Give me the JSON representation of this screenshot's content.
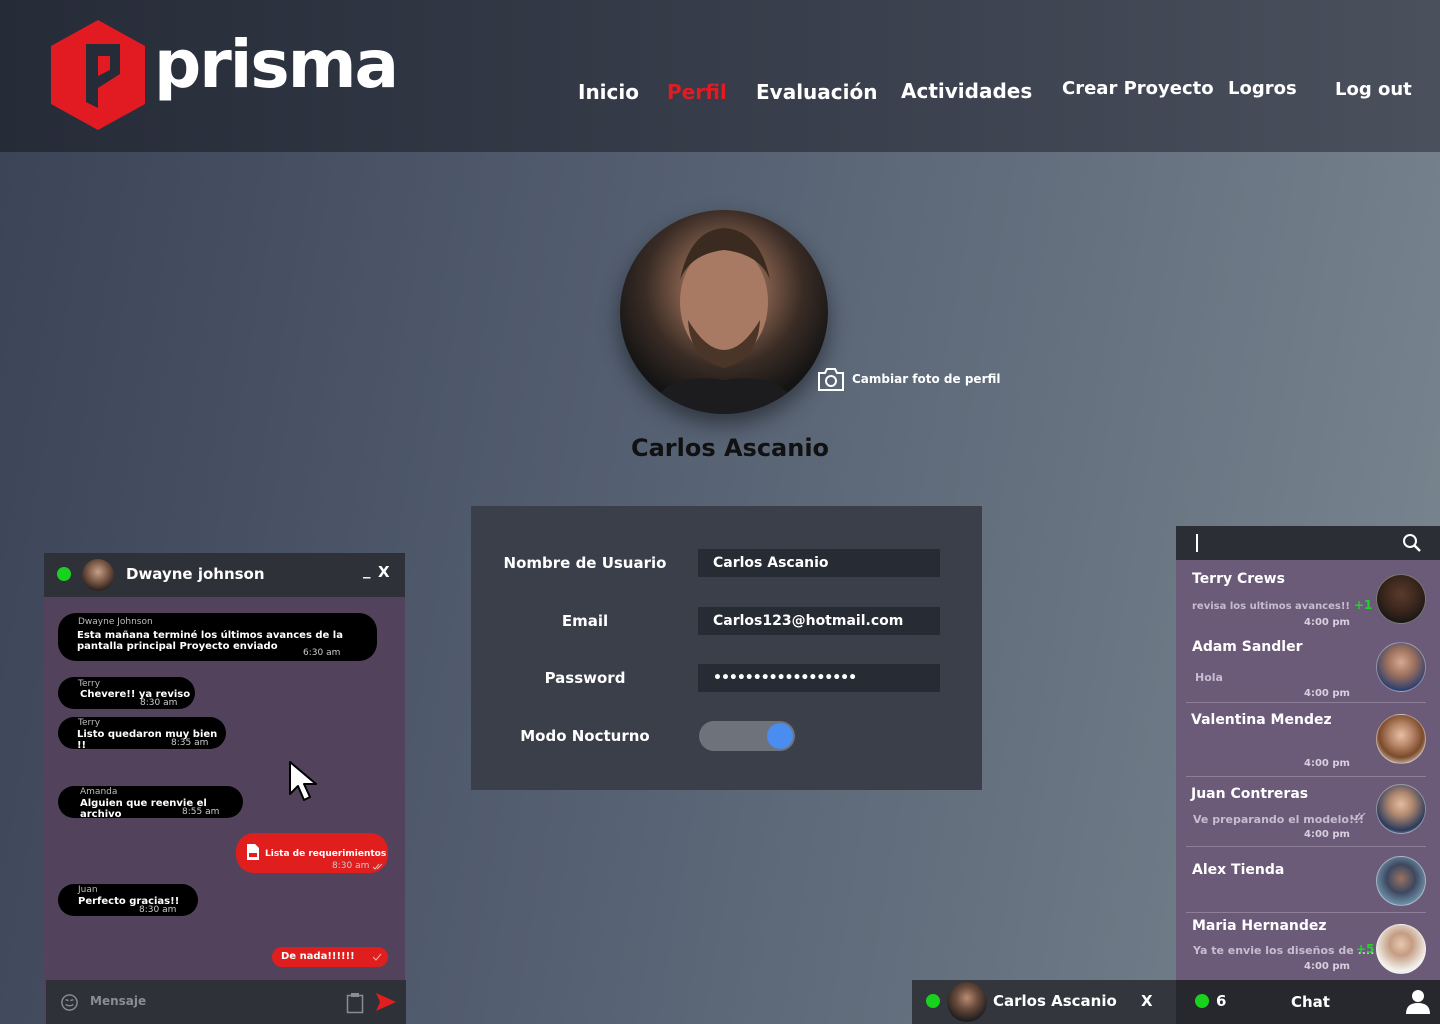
{
  "brand": {
    "name": "prisma",
    "accent": "#e21b23"
  },
  "nav": [
    {
      "label": "Inicio",
      "active": false
    },
    {
      "label": "Perfil",
      "active": true
    },
    {
      "label": "Evaluación",
      "active": false
    },
    {
      "label": "Actividades",
      "active": false
    },
    {
      "label": "Crear Proyecto",
      "active": false
    },
    {
      "label": "Logros",
      "active": false
    },
    {
      "label": "Log out",
      "active": false
    }
  ],
  "profile": {
    "name": "Carlos Ascanio",
    "change_photo_label": "Cambiar foto de perfil"
  },
  "form": {
    "username_label": "Nombre de Usuario",
    "username_value": "Carlos Ascanio",
    "email_label": "Email",
    "email_value": "Carlos123@hotmail.com",
    "password_label": "Password",
    "password_value": "••••••••••••••••••",
    "night_mode_label": "Modo Nocturno",
    "night_mode_on": true
  },
  "chat_window": {
    "title": "Dwayne johnson",
    "minimize_label": "_",
    "close_label": "X",
    "messages": [
      {
        "from": "Dwayne Johnson",
        "line1": "Esta mañana terminé los últimos avances de la",
        "line2": "pantalla principal Proyecto enviado",
        "time": "6:30 am"
      },
      {
        "from": "Terry",
        "line1": "Chevere!! ya reviso",
        "time": "8:30 am"
      },
      {
        "from": "Terry",
        "line1": "Listo quedaron muy bien !!",
        "time": "8:35 am"
      },
      {
        "from": "Amanda",
        "line1": "Alguien que reenvie el archivo",
        "time": "8:55 am"
      },
      {
        "file": "Lista de requerimientos",
        "time": "8:30 am"
      },
      {
        "from": "Juan",
        "line1": "Perfecto gracias!!",
        "time": "8:30 am"
      },
      {
        "line1": "De nada!!!!!!"
      }
    ],
    "input_placeholder": "Mensaje"
  },
  "chat_list": {
    "contacts": [
      {
        "name": "Terry Crews",
        "message": "revisa los ultimos avances!!",
        "badge": "+1",
        "time": "4:00 pm"
      },
      {
        "name": "Adam Sandler",
        "message": "Hola",
        "time": "4:00 pm"
      },
      {
        "name": "Valentina Mendez",
        "time": "4:00 pm"
      },
      {
        "name": "Juan Contreras",
        "message": "Ve preparando el modelo!!!",
        "time": "4:00 pm"
      },
      {
        "name": "Alex Tienda"
      },
      {
        "name": "Maria Hernandez",
        "message": "Ya te envie los diseños de ....",
        "badge": "+5",
        "time": "4:00 pm"
      }
    ]
  },
  "mini_chat": {
    "name": "Carlos Ascanio",
    "close_label": "X"
  },
  "chat_bar": {
    "online_count": "6",
    "label": "Chat"
  }
}
